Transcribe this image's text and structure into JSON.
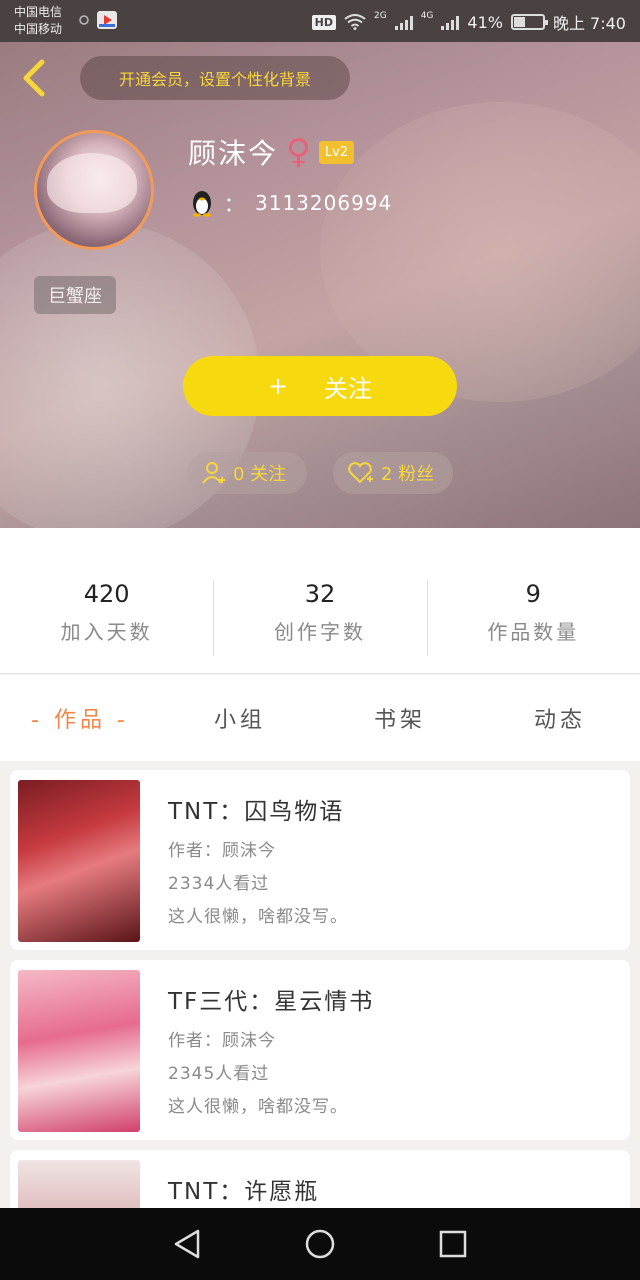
{
  "status_bar": {
    "carrier_1": "中国电信",
    "carrier_2": "中国移动",
    "signal_1_label": "2G",
    "signal_2_label": "4G",
    "battery": "41%",
    "battery_level": 0.41,
    "time": "晚上 7:40"
  },
  "header": {
    "vip_banner": "开通会员，设置个性化背景",
    "zodiac": "巨蟹座",
    "username": "顾沫今",
    "gender_symbol": "♀",
    "level": "Lv2",
    "qq_label": "：",
    "qq_number": "3113206994",
    "follow": {
      "plus": "+",
      "label": "关注"
    },
    "following_chip": "0 关注",
    "fans_chip": "2 粉丝"
  },
  "stats": [
    {
      "value": "420",
      "label": "加入天数"
    },
    {
      "value": "32",
      "label": "创作字数"
    },
    {
      "value": "9",
      "label": "作品数量"
    }
  ],
  "tabs": [
    {
      "label": "- 作品 -",
      "active": true
    },
    {
      "label": "小组"
    },
    {
      "label": "书架"
    },
    {
      "label": "动态"
    }
  ],
  "works": [
    {
      "title": "TNT：囚鸟物语",
      "author": "作者：顾沫今",
      "views": "2334人看过",
      "desc": "这人很懒，啥都没写。"
    },
    {
      "title": "TF三代：星云情书",
      "author": "作者：顾沫今",
      "views": "2345人看过",
      "desc": "这人很懒，啥都没写。"
    },
    {
      "title": "TNT：许愿瓶",
      "author": "",
      "views": "",
      "desc": ""
    }
  ],
  "colors": {
    "accent_yellow": "#f7d910",
    "tab_active": "#f0874a",
    "avatar_border": "#f39a59",
    "gender_pink": "#e9607a"
  }
}
